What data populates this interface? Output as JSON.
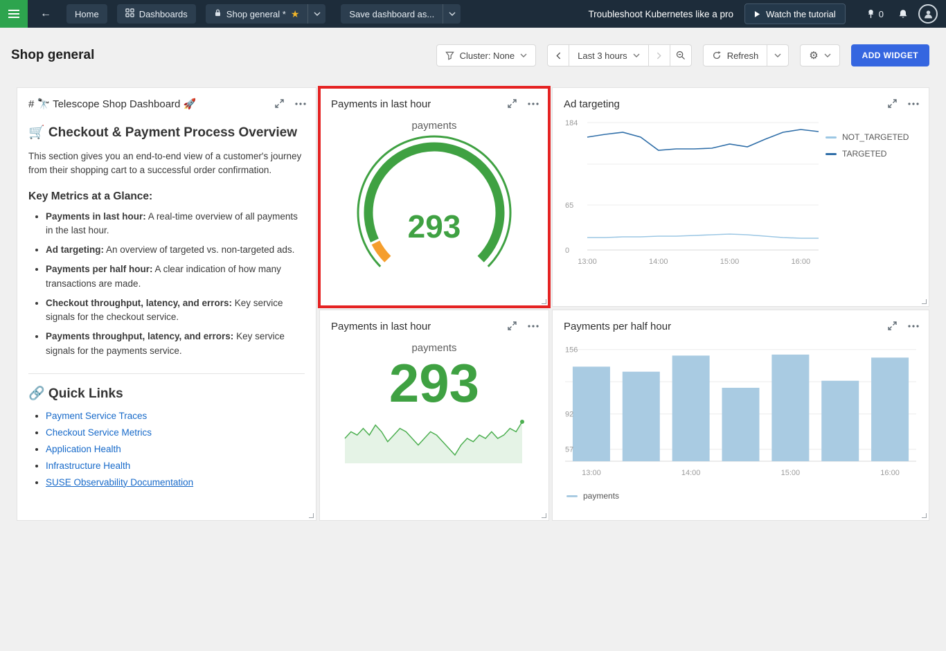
{
  "topbar": {
    "home_label": "Home",
    "dashboards_label": "Dashboards",
    "dashboard_name": "Shop general *",
    "save_as_label": "Save dashboard as...",
    "promo_text": "Troubleshoot Kubernetes like a pro",
    "watch_tutorial_label": "Watch the tutorial",
    "pin_count": "0"
  },
  "header": {
    "title": "Shop general",
    "cluster_filter_label": "Cluster: None",
    "time_range_label": "Last 3 hours",
    "refresh_label": "Refresh",
    "add_widget_label": "ADD WIDGET"
  },
  "notes_widget": {
    "title": "# 🔭 Telescope Shop Dashboard 🚀",
    "overview_heading": "🛒 Checkout & Payment Process Overview",
    "overview_text": "This section gives you an end-to-end view of a customer's journey from their shopping cart to a successful order confirmation.",
    "metrics_heading": "Key Metrics at a Glance:",
    "metrics": [
      {
        "label": "Payments in last hour:",
        "text": " A real-time overview of all payments in the last hour."
      },
      {
        "label": "Ad targeting:",
        "text": " An overview of targeted vs. non-targeted ads."
      },
      {
        "label": "Payments per half hour:",
        "text": " A clear indication of how many transactions are made."
      },
      {
        "label": "Checkout throughput, latency, and errors:",
        "text": " Key service signals for the checkout service."
      },
      {
        "label": "Payments throughput, latency, and errors:",
        "text": " Key service signals for the payments service."
      }
    ],
    "links_heading": "🔗 Quick Links",
    "links": [
      {
        "label": "Payment Service Traces"
      },
      {
        "label": "Checkout Service Metrics"
      },
      {
        "label": "Application Health"
      },
      {
        "label": "Infrastructure Health"
      },
      {
        "label": "SUSE Observability Documentation"
      }
    ]
  },
  "gauge_widget": {
    "title": "Payments in last hour",
    "series_label": "payments",
    "value": "293"
  },
  "trend_widget": {
    "title": "Payments in last hour",
    "series_label": "payments",
    "value": "293"
  },
  "ad_widget": {
    "title": "Ad targeting"
  },
  "bar_widget": {
    "title": "Payments per half hour",
    "legend_label": "payments"
  },
  "chart_data": [
    {
      "id": "payments-gauge",
      "type": "gauge",
      "title": "Payments in last hour",
      "series": "payments",
      "value": 293,
      "color_main": "#3fa142",
      "color_warn": "#f59e2d",
      "warn_fraction": 0.07,
      "span_degrees": 270
    },
    {
      "id": "payments-trend",
      "type": "area",
      "title": "Payments in last hour",
      "series": "payments",
      "value": 293,
      "color": "#4caf50",
      "values": [
        291,
        293,
        292,
        294,
        292,
        295,
        293,
        290,
        292,
        294,
        293,
        291,
        289,
        291,
        293,
        292,
        290,
        288,
        286,
        289,
        291,
        290,
        292,
        291,
        293,
        291,
        292,
        294,
        293,
        296
      ]
    },
    {
      "id": "ad-targeting",
      "type": "line",
      "title": "Ad targeting",
      "x": [
        "13:00",
        "13:15",
        "13:30",
        "13:45",
        "14:00",
        "14:15",
        "14:30",
        "14:45",
        "15:00",
        "15:15",
        "15:30",
        "15:45",
        "16:00",
        "16:15"
      ],
      "series": [
        {
          "name": "NOT_TARGETED",
          "color": "#9cc7e4",
          "values": [
            18,
            18,
            19,
            19,
            20,
            20,
            21,
            22,
            23,
            22,
            20,
            18,
            17,
            17
          ]
        },
        {
          "name": "TARGETED",
          "color": "#2f6ea8",
          "values": [
            163,
            167,
            170,
            163,
            144,
            146,
            146,
            147,
            153,
            149,
            160,
            170,
            174,
            171
          ]
        }
      ],
      "ylim": [
        0,
        184
      ],
      "yticks": [
        {
          "value": 184,
          "label": "184"
        },
        {
          "value": 124,
          "label": ""
        },
        {
          "value": 65,
          "label": "65"
        },
        {
          "value": 0,
          "label": "0"
        }
      ],
      "xticks": [
        {
          "index": 0,
          "label": "13:00"
        },
        {
          "index": 4,
          "label": "14:00"
        },
        {
          "index": 8,
          "label": "15:00"
        },
        {
          "index": 12,
          "label": "16:00"
        }
      ],
      "legend_position": "right",
      "grid": true
    },
    {
      "id": "payments-per-half-hour",
      "type": "bar",
      "title": "Payments per half hour",
      "categories": [
        "13:00",
        "13:30",
        "14:00",
        "14:30",
        "15:00",
        "15:30",
        "16:00"
      ],
      "values": [
        139,
        134,
        150,
        118,
        151,
        125,
        148
      ],
      "color": "#a9cbe2",
      "ylim": [
        45,
        162
      ],
      "yticks": [
        {
          "value": 156,
          "label": "156"
        },
        {
          "value": 124,
          "label": ""
        },
        {
          "value": 92,
          "label": "92"
        },
        {
          "value": 57,
          "label": "57"
        }
      ],
      "xticks": [
        {
          "index": 0,
          "label": "13:00"
        },
        {
          "index": 2,
          "label": "14:00"
        },
        {
          "index": 4,
          "label": "15:00"
        },
        {
          "index": 6,
          "label": "16:00"
        }
      ],
      "legend": "payments",
      "legend_position": "bottom",
      "grid": true
    }
  ]
}
